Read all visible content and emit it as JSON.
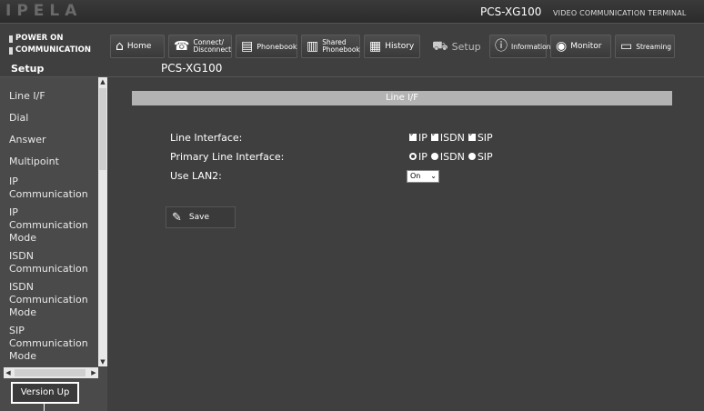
{
  "header": {
    "logo": "IPELA",
    "model": "PCS-XG100",
    "terminal_label": "VIDEO COMMUNICATION TERMINAL"
  },
  "status": {
    "power": "POWER ON",
    "communication": "COMMUNICATION"
  },
  "nav": [
    {
      "label": "Home",
      "icon": "home-icon"
    },
    {
      "label": "Connect/ Disconnect",
      "line1": "Connect/",
      "line2": "Disconnect",
      "icon": "phone-icon"
    },
    {
      "label": "Phonebook",
      "icon": "phonebook-icon"
    },
    {
      "label": "Shared Phonebook",
      "line1": "Shared",
      "line2": "Phonebook",
      "icon": "shared-phonebook-icon"
    },
    {
      "label": "History",
      "icon": "history-icon"
    },
    {
      "label": "Setup",
      "icon": "setup-icon"
    },
    {
      "label": "Information",
      "icon": "information-icon"
    },
    {
      "label": "Monitor",
      "icon": "monitor-icon"
    },
    {
      "label": "Streaming",
      "icon": "streaming-icon"
    }
  ],
  "breadcrumb": {
    "section": "Setup",
    "model": "PCS-XG100"
  },
  "sidebar": {
    "items": [
      {
        "label": "Line I/F"
      },
      {
        "label": "Dial"
      },
      {
        "label": "Answer"
      },
      {
        "label": "Multipoint"
      },
      {
        "label": "IP Communication",
        "line1": "IP",
        "line2": "Communication"
      },
      {
        "label": "IP Communication Mode",
        "line1": "IP",
        "line2": "Communication",
        "line3": "Mode"
      },
      {
        "label": "ISDN Communication",
        "line1": "ISDN",
        "line2": "Communication"
      },
      {
        "label": "ISDN Communication Mode",
        "line1": "ISDN",
        "line2": "Communication",
        "line3": "Mode"
      },
      {
        "label": "SIP Communication Mode",
        "line1": "SIP",
        "line2": "Communication",
        "line3": "Mode"
      }
    ],
    "version_up_label": "Version Up"
  },
  "main": {
    "title": "Line I/F",
    "line_interface": {
      "label": "Line Interface:",
      "options": [
        {
          "label": "IP",
          "checked": true
        },
        {
          "label": "ISDN",
          "checked": true
        },
        {
          "label": "SIP",
          "checked": true
        }
      ]
    },
    "primary_line_interface": {
      "label": "Primary Line Interface:",
      "options": [
        {
          "label": "IP",
          "selected": true
        },
        {
          "label": "ISDN",
          "selected": false
        },
        {
          "label": "SIP",
          "selected": false
        }
      ]
    },
    "use_lan2": {
      "label": "Use LAN2:",
      "value": "On"
    },
    "save_label": "Save"
  }
}
